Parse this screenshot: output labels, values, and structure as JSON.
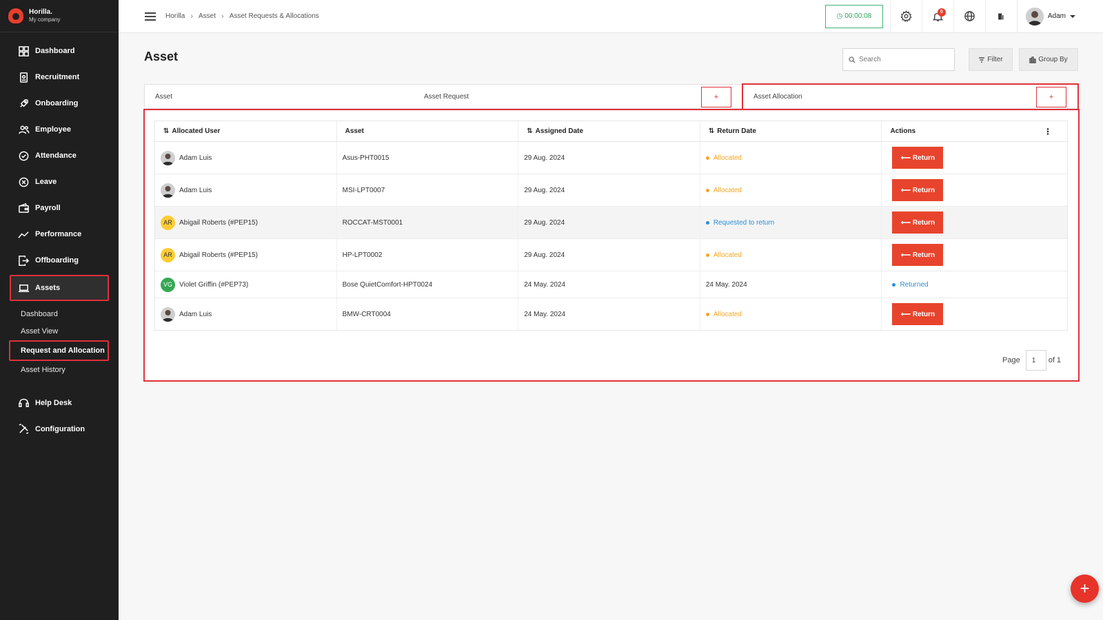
{
  "brand": {
    "name": "Horilla.",
    "company": "My company"
  },
  "sidebar": {
    "items": [
      {
        "label": "Dashboard",
        "icon": "dashboard-icon"
      },
      {
        "label": "Recruitment",
        "icon": "recruitment-icon"
      },
      {
        "label": "Onboarding",
        "icon": "rocket-icon"
      },
      {
        "label": "Employee",
        "icon": "people-icon"
      },
      {
        "label": "Attendance",
        "icon": "check-circle-icon"
      },
      {
        "label": "Leave",
        "icon": "x-circle-icon"
      },
      {
        "label": "Payroll",
        "icon": "wallet-icon"
      },
      {
        "label": "Performance",
        "icon": "trend-icon"
      },
      {
        "label": "Offboarding",
        "icon": "exit-icon"
      },
      {
        "label": "Assets",
        "icon": "laptop-icon"
      }
    ],
    "assets_submenu": [
      "Dashboard",
      "Asset View",
      "Request and Allocation",
      "Asset History"
    ],
    "bottom_items": [
      {
        "label": "Help Desk",
        "icon": "headset-icon"
      },
      {
        "label": "Configuration",
        "icon": "tools-icon"
      }
    ]
  },
  "header": {
    "breadcrumb": [
      "Horilla",
      "Asset",
      "Asset Requests & Allocations"
    ],
    "timer": "00:00:08",
    "notification_count": "0",
    "user_name": "Adam"
  },
  "page": {
    "title": "Asset",
    "search_placeholder": "Search",
    "filter_label": "Filter",
    "groupby_label": "Group By"
  },
  "tabs": {
    "asset": "Asset",
    "asset_request": "Asset Request",
    "asset_allocation": "Asset Allocation",
    "add_symbol": "+"
  },
  "table": {
    "headers": [
      "Allocated User",
      "Asset",
      "Assigned Date",
      "Return Date",
      "Actions"
    ],
    "return_label": "⟵ Return",
    "rows": [
      {
        "user": "Adam Luis",
        "initials": "",
        "asset": "Asus-PHT0015",
        "assigned": "29 Aug. 2024",
        "status": "Allocated",
        "status_color": "#f5a623",
        "return_date": "",
        "action": true
      },
      {
        "user": "Adam Luis",
        "initials": "",
        "asset": "MSI-LPT0007",
        "assigned": "29 Aug. 2024",
        "status": "Allocated",
        "status_color": "#f5a623",
        "return_date": "",
        "action": true
      },
      {
        "user": "Abigail Roberts (#PEP15)",
        "initials": "AR",
        "asset": "ROCCAT-MST0001",
        "assigned": "29 Aug. 2024",
        "status": "Requested to return",
        "status_color": "#2a8fd6",
        "return_date": "",
        "action": true
      },
      {
        "user": "Abigail Roberts (#PEP15)",
        "initials": "AR",
        "asset": "HP-LPT0002",
        "assigned": "29 Aug. 2024",
        "status": "Allocated",
        "status_color": "#f5a623",
        "return_date": "",
        "action": true
      },
      {
        "user": "Violet Griffin (#PEP73)",
        "initials": "VG",
        "asset": "Bose QuietComfort-HPT0024",
        "assigned": "24 May. 2024",
        "status": "",
        "status_color": "",
        "return_date": "24 May. 2024",
        "action_status": "Returned",
        "action_status_color": "#2a8fd6",
        "action": false
      },
      {
        "user": "Adam Luis",
        "initials": "",
        "asset": "BMW-CRT0004",
        "assigned": "24 May. 2024",
        "status": "Allocated",
        "status_color": "#f5a623",
        "return_date": "",
        "action": true
      }
    ]
  },
  "pagination": {
    "page_label": "Page",
    "current": "1",
    "of_label": "of 1"
  },
  "colors": {
    "accent": "#e8442d",
    "highlight": "#e0313b",
    "sidebar": "#1f1f1f"
  }
}
